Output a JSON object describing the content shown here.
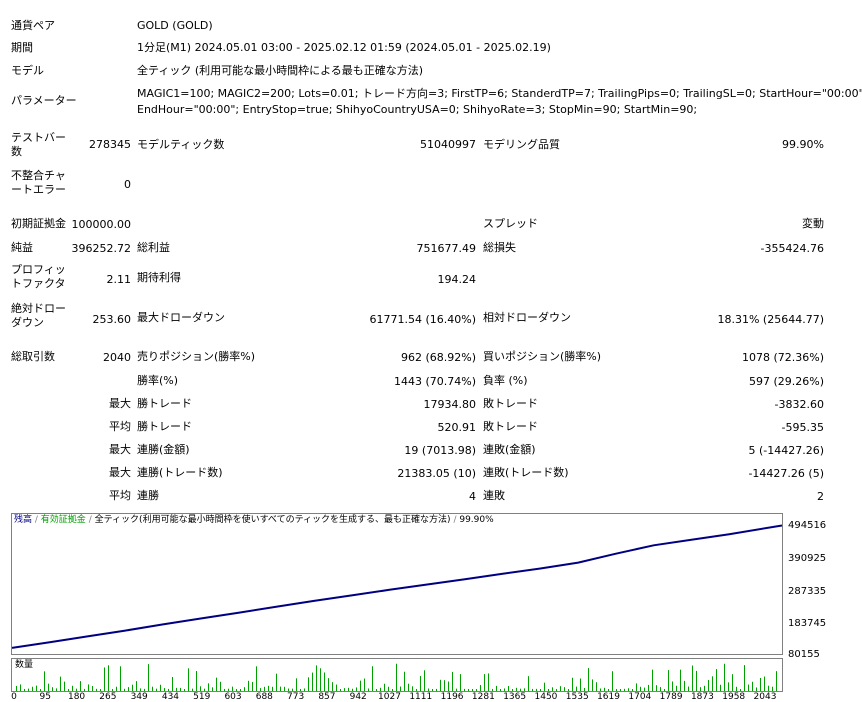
{
  "report": {
    "symbol": {
      "label": "通貨ペア",
      "value": "GOLD (GOLD)"
    },
    "period": {
      "label": "期間",
      "value": "1分足(M1) 2024.05.01 03:00 - 2025.02.12 01:59 (2024.05.01 - 2025.02.19)"
    },
    "model": {
      "label": "モデル",
      "value": "全ティック (利用可能な最小時間枠による最も正確な方法)"
    },
    "params": {
      "label": "パラメーター",
      "line1": "MAGIC1=100; MAGIC2=200; Lots=0.01; トレード方向=3; FirstTP=6; StanderdTP=7; TrailingPips=0; TrailingSL=0; StartHour=\"00:00\";",
      "line2": "EndHour=\"00:00\"; EntryStop=true; ShihyoCountryUSA=0; ShihyoRate=3; StopMin=90; StartMin=90;"
    },
    "bars": {
      "label": "テストバー数",
      "value": "278345"
    },
    "ticks": {
      "label": "モデルティック数",
      "value": "51040997"
    },
    "quality": {
      "label": "モデリング品質",
      "value": "99.90%"
    },
    "mismatch": {
      "label": "不整合チャートエラー",
      "value": "0"
    },
    "deposit": {
      "label": "初期証拠金",
      "value": "100000.00"
    },
    "spread": {
      "label": "スプレッド",
      "value": "変動"
    },
    "net_profit": {
      "label": "純益",
      "value": "396252.72"
    },
    "gross_profit": {
      "label": "総利益",
      "value": "751677.49"
    },
    "gross_loss": {
      "label": "総損失",
      "value": "-355424.76"
    },
    "profit_factor": {
      "label": "プロフィットファクタ",
      "value": "2.11"
    },
    "expected_payoff": {
      "label": "期待利得",
      "value": "194.24"
    },
    "abs_dd": {
      "label": "絶対ドローダウン",
      "value": "253.60"
    },
    "max_dd": {
      "label": "最大ドローダウン",
      "value": "61771.54 (16.40%)"
    },
    "rel_dd": {
      "label": "相対ドローダウン",
      "value": "18.31% (25644.77)"
    },
    "total_trades": {
      "label": "総取引数",
      "value": "2040"
    },
    "short_pos": {
      "label": "売りポジション(勝率%)",
      "value": "962 (68.92%)"
    },
    "long_pos": {
      "label": "買いポジション(勝率%)",
      "value": "1078 (72.36%)"
    },
    "win_rate": {
      "label": "勝率(%)",
      "value": "1443 (70.74%)"
    },
    "loss_rate": {
      "label": "負率 (%)",
      "value": "597 (29.26%)"
    },
    "largest": {
      "prefix": "最大",
      "win_label": "勝トレード",
      "win": "17934.80",
      "loss_label": "敗トレード",
      "loss": "-3832.60"
    },
    "average": {
      "prefix": "平均",
      "win_label": "勝トレード",
      "win": "520.91",
      "loss_label": "敗トレード",
      "loss": "-595.35"
    },
    "max_consec": {
      "prefix": "最大",
      "win_label": "連勝(金額)",
      "win": "19 (7013.98)",
      "loss_label": "連敗(金額)",
      "loss": "5 (-14427.26)"
    },
    "max_consec_amt": {
      "prefix": "最大",
      "win_label": "連勝(トレード数)",
      "win": "21383.05 (10)",
      "loss_label": "連敗(トレード数)",
      "loss": "-14427.26 (5)"
    },
    "avg_consec": {
      "prefix": "平均",
      "win_label": "連勝",
      "win": "4",
      "loss_label": "連敗",
      "loss": "2"
    }
  },
  "chart_data": {
    "type": "line",
    "legend": {
      "balance": "残高",
      "equity": "有効証拠金",
      "model": "全ティック(利用可能な最小時間枠を使いすべてのティックを生成する、最も正確な方法)",
      "quality": "99.90%"
    },
    "volume_label": "数量",
    "y_ticks": [
      "494516",
      "390925",
      "287335",
      "183745",
      "80155"
    ],
    "x_ticks": [
      "0",
      "95",
      "180",
      "265",
      "349",
      "434",
      "519",
      "603",
      "688",
      "773",
      "857",
      "942",
      "1027",
      "1111",
      "1196",
      "1281",
      "1365",
      "1450",
      "1535",
      "1619",
      "1704",
      "1789",
      "1873",
      "1958",
      "2043"
    ],
    "x": [
      0,
      100,
      200,
      300,
      400,
      500,
      600,
      700,
      800,
      900,
      1000,
      1100,
      1200,
      1300,
      1400,
      1500,
      1600,
      1700,
      1800,
      1900,
      2040
    ],
    "balance": [
      100000,
      118000,
      137000,
      156000,
      176000,
      195000,
      214000,
      233000,
      252000,
      270000,
      288000,
      305000,
      322000,
      340000,
      357000,
      376000,
      405000,
      432000,
      450000,
      468000,
      496252
    ],
    "ylim": [
      80155,
      494516
    ],
    "colors": {
      "balance": "#000080",
      "volume": "#00a000",
      "frame": "#808080"
    }
  }
}
